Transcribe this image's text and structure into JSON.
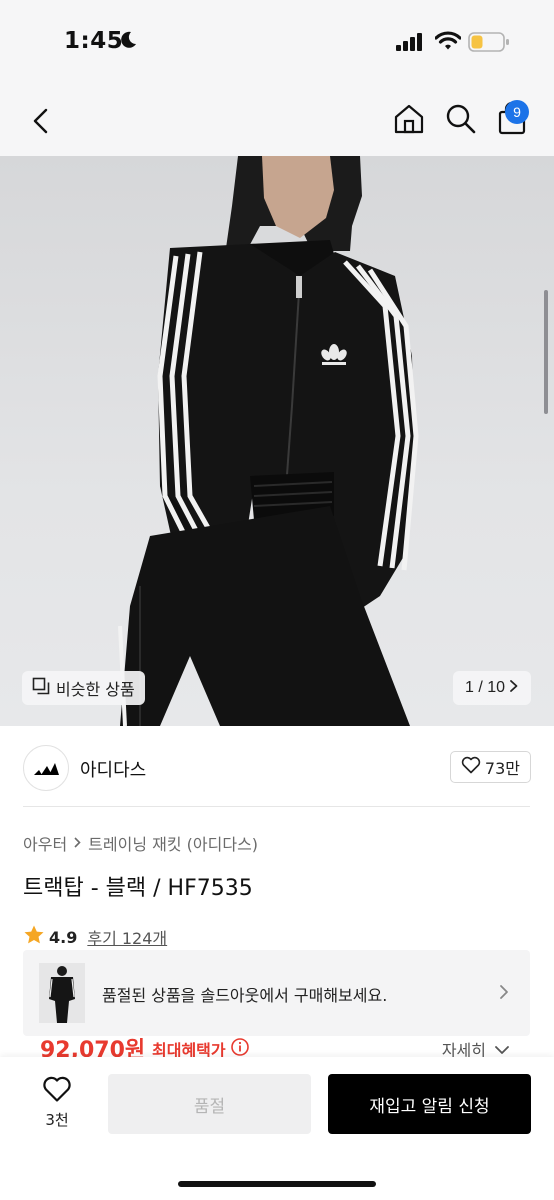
{
  "status_bar": {
    "time": "1:45"
  },
  "nav": {
    "cart_count": "9"
  },
  "gallery": {
    "similar_label": "비슷한 상품",
    "counter": "1 / 10"
  },
  "brand": {
    "name": "아디다스",
    "likes": "73만"
  },
  "breadcrumb": {
    "level1": "아우터",
    "level2": "트레이닝 재킷 (아디다스)"
  },
  "product": {
    "title": "트랙탑 - 블랙 / HF7535"
  },
  "rating": {
    "score": "4.9",
    "reviews": "후기 124개"
  },
  "soldout_banner": {
    "text": "품절된 상품을 솔드아웃에서 구매해보세요."
  },
  "price": {
    "amount": "92,070원",
    "benefit_label": "최대혜택가",
    "detail_label": "자세히"
  },
  "bottom_bar": {
    "wish_count": "3천",
    "soldout_label": "품절",
    "restock_label": "재입고 알림 신청"
  },
  "colors": {
    "accent_blue": "#1c73e8",
    "price_red": "#e83a2f",
    "cta_black": "#000000"
  }
}
